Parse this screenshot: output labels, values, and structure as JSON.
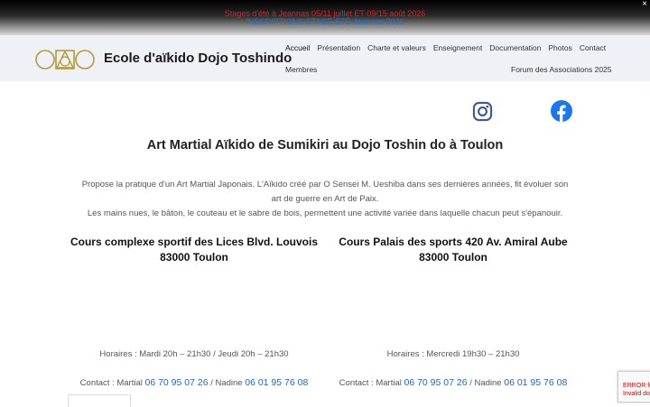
{
  "announcement": {
    "line1": "Stages d'été à Jeannas 05/11 juillet ET 09/15 août 2026",
    "line2": "INSCRIPTIONS STAGE ÉTÉ Jeannas 2026",
    "close": "×"
  },
  "header": {
    "brand": "Ecole d'aïkido Dojo Toshindo",
    "nav_row1": [
      "Accueil",
      "Présentation",
      "Charte et valeurs",
      "Enseignement",
      "Documentation",
      "Photos",
      "Contact"
    ],
    "nav_row2_left": "Membres",
    "nav_row2_right": "Forum des Associations 2025"
  },
  "social": {
    "icons": [
      "instagram-icon",
      "facebook-icon"
    ]
  },
  "main": {
    "title": "Art Martial Aïkido de Sumikiri au Dojo Toshin do à Toulon",
    "desc1": "Propose la pratique d'un Art Martial Japonais. L'Aïkido créé par O Sensei M. Ueshiba dans ses dernières années, fit évoluer son",
    "desc2": "art de  guerre en Art de Paix.",
    "desc3": "Les mains nues, le bâton, le couteau et le sabre de bois, permettent une activité variée dans laquelle chacun peut s'épanouir."
  },
  "venues": [
    {
      "name_line1": "Cours complexe sportif des Lices Blvd. Louvois",
      "name_line2": "83000 Toulon",
      "hours": "Horaires : Mardi 20h – 21h30 / Jeudi 20h – 21h30",
      "contact_prefix": "Contact : Martial ",
      "phone1": "06 70 95 07 26",
      "sep": " / Nadine ",
      "phone2": "06 01 95 76 08"
    },
    {
      "name_line1": "Cours Palais des sports 420 Av. Amiral Aube",
      "name_line2": "83000 Toulon",
      "hours": "Horaires : Mercredi 19h30 – 21h30",
      "contact_prefix": "Contact : Martial ",
      "phone1": "06 70 95 07 26",
      "sep": " / Nadine ",
      "phone2": "06 01 95 76 08"
    }
  ],
  "recaptcha": {
    "line1": "ERROR for",
    "line2": "Invalid do"
  },
  "colors": {
    "accent_red": "#e01e1e",
    "link_blue": "#2767b8",
    "logo_gold": "#b59a3a",
    "instagram": "#3d5a96",
    "facebook": "#1877f2"
  }
}
